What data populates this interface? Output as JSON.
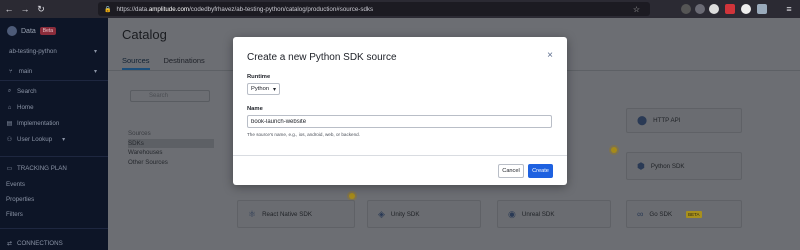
{
  "browser": {
    "url_prefix": "https://data.",
    "url_domain": "amplitude.com",
    "url_rest": "/codedbyfrhavez/ab-testing-python/catalog/production#source-sdks"
  },
  "sidebar": {
    "app_name": "Data",
    "badge": "Beta",
    "project": "ab-testing-python",
    "branch": "main",
    "nav": [
      {
        "label": "Search",
        "icon": "search-icon"
      },
      {
        "label": "Home",
        "icon": "home-icon"
      },
      {
        "label": "Implementation",
        "icon": "implementation-icon"
      },
      {
        "label": "User Lookup",
        "icon": "user-lookup-icon"
      }
    ],
    "section_tracking": "TRACKING PLAN",
    "tracking_items": [
      "Events",
      "Properties",
      "Filters"
    ],
    "section_connections": "CONNECTIONS"
  },
  "main": {
    "title": "Catalog",
    "tabs": [
      "Sources",
      "Destinations"
    ],
    "search_placeholder": "Search",
    "categories": {
      "header": "Sources",
      "items": [
        "SDKs",
        "Warehouses",
        "Other Sources"
      ]
    },
    "cards": {
      "http_api": "HTTP API",
      "python_sdk": "Python SDK",
      "react_native": "React Native SDK",
      "unity": "Unity SDK",
      "unreal": "Unreal SDK",
      "go": "Go SDK",
      "go_badge": "BETA"
    }
  },
  "modal": {
    "title": "Create a new Python SDK source",
    "runtime_label": "Runtime",
    "runtime_value": "Python",
    "name_label": "Name",
    "name_value": "book-launch-website",
    "name_hint": "The source's name, e.g., ios, android, web, or backend.",
    "cancel": "Cancel",
    "create": "Create"
  }
}
